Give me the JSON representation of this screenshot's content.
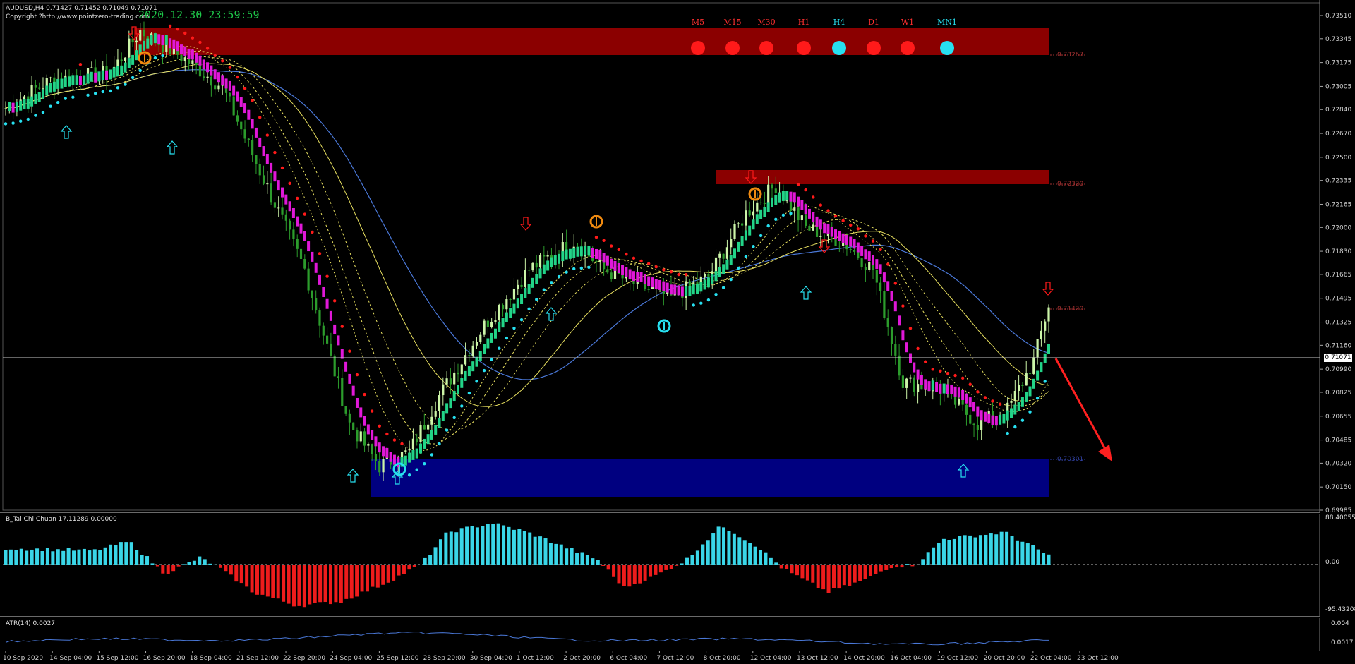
{
  "header": {
    "symbol_line": "AUDUSD,H4  0.71427 0.71452 0.71049 0.71071",
    "copyright": "Copyright ?http://www.pointzero-trading.com",
    "timestamp": "2020.12.30  23:59:59"
  },
  "timeframes": [
    {
      "label": "M5",
      "state_color": "#ff1a1a"
    },
    {
      "label": "M15",
      "state_color": "#ff1a1a"
    },
    {
      "label": "M30",
      "state_color": "#ff1a1a"
    },
    {
      "label": "H1",
      "state_color": "#ff1a1a"
    },
    {
      "label": "H4",
      "state_color": "#27e0f0"
    },
    {
      "label": "D1",
      "state_color": "#ff1a1a"
    },
    {
      "label": "W1",
      "state_color": "#ff1a1a"
    },
    {
      "label": "MN1",
      "state_color": "#27e0f0"
    }
  ],
  "timeframe_label_colors": {
    "red": "#ff3030",
    "cyan": "#27e0f0"
  },
  "price_axis": {
    "ticks": [
      "0.73510",
      "0.73345",
      "0.73175",
      "0.73005",
      "0.72840",
      "0.72670",
      "0.72500",
      "0.72335",
      "0.72165",
      "0.72000",
      "0.71830",
      "0.71665",
      "0.71495",
      "0.71325",
      "0.71160",
      "0.70990",
      "0.70825",
      "0.70655",
      "0.70485",
      "0.70320",
      "0.70150",
      "0.69985"
    ],
    "current_price": "0.71071"
  },
  "zone_labels": {
    "top_supply": "0.73257",
    "mid_supply": "0.72320",
    "small_supply": "0.71420",
    "demand": "0.70301"
  },
  "indicators": {
    "tai_chi": {
      "title": "B_Tai Chi Chuan 17.11289 0.00000",
      "max_label": "88.40055",
      "zero_label": "0.00",
      "min_label": "-95.43208",
      "pos_color": "#3ad6e8",
      "neg_color": "#ee1c1c"
    },
    "atr": {
      "title": "ATR(14) 0.0027",
      "max_label": "0.004",
      "min_label": "0.0017"
    }
  },
  "time_axis": [
    "10 Sep 2020",
    "14 Sep 04:00",
    "15 Sep 12:00",
    "16 Sep 20:00",
    "18 Sep 04:00",
    "21 Sep 12:00",
    "22 Sep 20:00",
    "24 Sep 04:00",
    "25 Sep 12:00",
    "28 Sep 20:00",
    "30 Sep 04:00",
    "1 Oct 12:00",
    "2 Oct 20:00",
    "6 Oct 04:00",
    "7 Oct 12:00",
    "8 Oct 20:00",
    "12 Oct 04:00",
    "13 Oct 12:00",
    "14 Oct 20:00",
    "16 Oct 04:00",
    "19 Oct 12:00",
    "20 Oct 20:00",
    "22 Oct 04:00",
    "23 Oct 12:00"
  ],
  "colors": {
    "supply_zone": "#8b0000",
    "demand_zone": "#000080",
    "bull_candle": "#ccf5a8",
    "bear_candle": "#2c9c2c",
    "trend_up": "#22d488",
    "trend_down": "#e018d8",
    "stop_down": "#ff1a1a",
    "stop_up": "#27e0f0",
    "ma_blue": "#4a78d8",
    "ma_yellow": "#e8e060",
    "arrow": "#ff2020"
  }
}
